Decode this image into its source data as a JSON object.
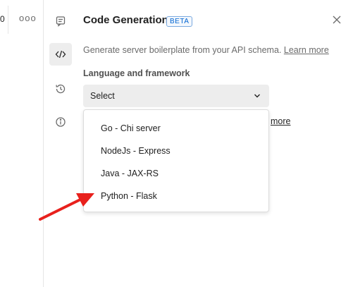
{
  "left": {
    "tab_stub_text": "0",
    "more_label": "ooo"
  },
  "rail": {
    "items": [
      {
        "name": "comments-icon"
      },
      {
        "name": "code-icon"
      },
      {
        "name": "history-icon"
      },
      {
        "name": "info-icon"
      }
    ]
  },
  "panel": {
    "title": "Code Generation",
    "badge": "BETA",
    "description": "Generate server boilerplate from your API schema.",
    "learn_more": "Learn more",
    "section_label": "Language and framework",
    "select_value": "Select",
    "behind_link": "more"
  },
  "dropdown": {
    "options": [
      "Go - Chi server",
      "NodeJs - Express",
      "Java - JAX-RS",
      "Python - Flask"
    ]
  },
  "colors": {
    "accent": "#0265d2",
    "annotation_arrow": "#e8201c"
  }
}
